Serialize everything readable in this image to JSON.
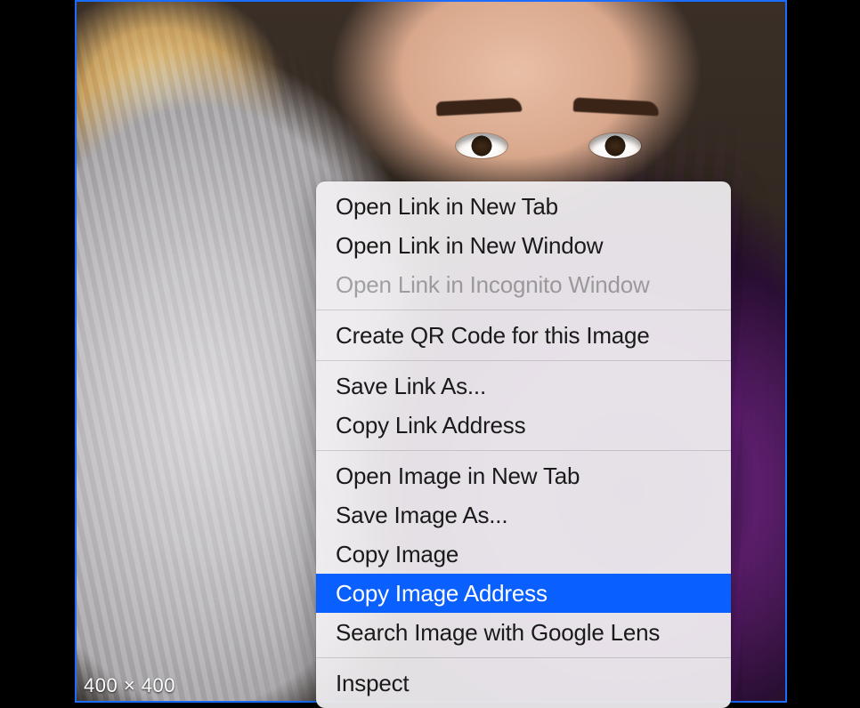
{
  "image": {
    "dimensions_label": "400 × 400"
  },
  "contextMenu": {
    "groups": [
      [
        {
          "label": "Open Link in New Tab",
          "disabled": false,
          "highlighted": false
        },
        {
          "label": "Open Link in New Window",
          "disabled": false,
          "highlighted": false
        },
        {
          "label": "Open Link in Incognito Window",
          "disabled": true,
          "highlighted": false
        }
      ],
      [
        {
          "label": "Create QR Code for this Image",
          "disabled": false,
          "highlighted": false
        }
      ],
      [
        {
          "label": "Save Link As...",
          "disabled": false,
          "highlighted": false
        },
        {
          "label": "Copy Link Address",
          "disabled": false,
          "highlighted": false
        }
      ],
      [
        {
          "label": "Open Image in New Tab",
          "disabled": false,
          "highlighted": false
        },
        {
          "label": "Save Image As...",
          "disabled": false,
          "highlighted": false
        },
        {
          "label": "Copy Image",
          "disabled": false,
          "highlighted": false
        },
        {
          "label": "Copy Image Address",
          "disabled": false,
          "highlighted": true
        },
        {
          "label": "Search Image with Google Lens",
          "disabled": false,
          "highlighted": false
        }
      ],
      [
        {
          "label": "Inspect",
          "disabled": false,
          "highlighted": false
        }
      ]
    ]
  }
}
